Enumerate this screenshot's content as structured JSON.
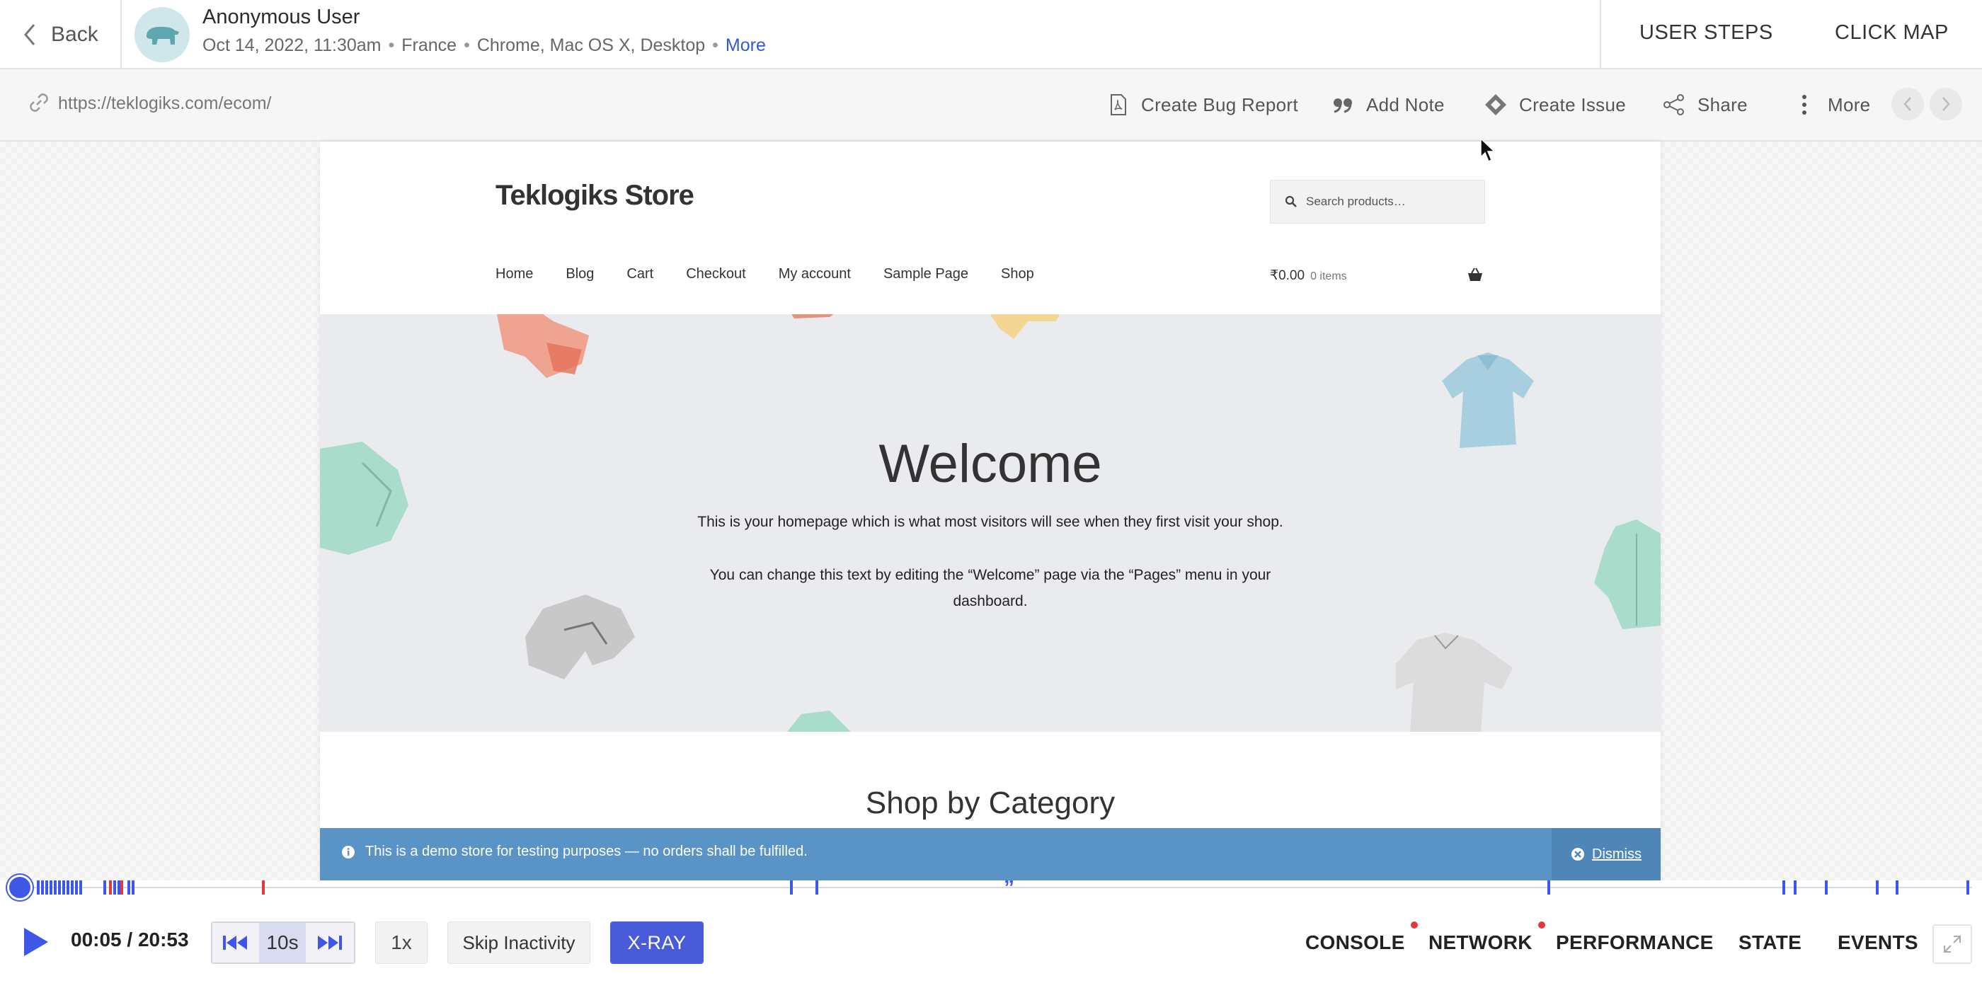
{
  "header": {
    "back_label": "Back",
    "user_name": "Anonymous User",
    "datetime": "Oct 14, 2022, 11:30am",
    "location": "France",
    "environment": "Chrome, Mac OS X, Desktop",
    "more_label": "More",
    "tabs": [
      "USER STEPS",
      "CLICK MAP"
    ]
  },
  "urlbar": {
    "url": "https://teklogiks.com/ecom/",
    "actions": {
      "bug": "Create Bug Report",
      "note": "Add Note",
      "issue": "Create Issue",
      "share": "Share",
      "more": "More"
    }
  },
  "site": {
    "title": "Teklogiks Store",
    "search_placeholder": "Search products…",
    "nav": [
      "Home",
      "Blog",
      "Cart",
      "Checkout",
      "My account",
      "Sample Page",
      "Shop"
    ],
    "cart_amount": "₹0.00",
    "cart_items": "0 items",
    "hero_title": "Welcome",
    "hero_p1": "This is your homepage which is what most visitors will see when they first visit your shop.",
    "hero_p2": "You can change this text by editing the “Welcome” page via the “Pages” menu in your dashboard.",
    "section_title": "Shop by Category",
    "notice": "This is a demo store for testing purposes — no orders shall be fulfilled.",
    "dismiss": "Dismiss"
  },
  "player": {
    "current_time": "00:05",
    "total_time": "20:53",
    "time_display": "00:05 / 20:53",
    "skip_label": "10s",
    "speed": "1x",
    "skip_inactivity": "Skip Inactivity",
    "xray": "X-RAY",
    "progress_fraction": 0.004
  },
  "devtools_tabs": {
    "console": "CONSOLE",
    "network": "NETWORK",
    "performance": "PERFORMANCE",
    "state": "STATE",
    "events": "EVENTS"
  },
  "colors": {
    "accent": "#3f57e8",
    "error_marker": "#e2383f",
    "notice_bg": "#5a94c7",
    "xray_bg": "#4a5bd9"
  },
  "icons": [
    "chevron-left-icon",
    "bear-avatar-icon",
    "link-icon",
    "pdf-icon",
    "quote-icon",
    "diamond-icon",
    "share-icon",
    "kebab-icon",
    "search-icon",
    "basket-icon",
    "info-icon",
    "close-circle-icon",
    "play-icon",
    "rewind-icon",
    "fast-forward-icon",
    "expand-icon"
  ]
}
